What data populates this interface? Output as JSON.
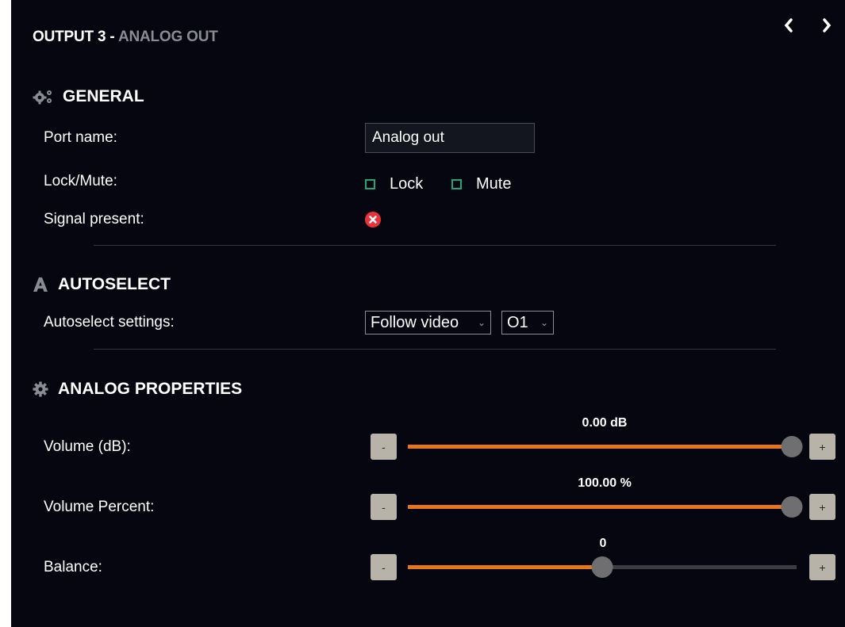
{
  "header": {
    "title": "OUTPUT 3 - ",
    "subtitle": "ANALOG OUT"
  },
  "nav": {
    "prev_icon": "chevron-left-icon",
    "next_icon": "chevron-right-icon"
  },
  "general": {
    "title": "GENERAL",
    "icon": "gears-icon",
    "port_name_label": "Port name:",
    "port_name_value": "Analog out",
    "lock_mute_label": "Lock/Mute:",
    "lock_label": "Lock",
    "lock_checked": false,
    "mute_label": "Mute",
    "mute_checked": false,
    "signal_label": "Signal present:",
    "signal_present": false,
    "signal_icon": "error-x-icon"
  },
  "autoselect": {
    "title": "AUTOSELECT",
    "icon": "letter-a-icon",
    "settings_label": "Autoselect settings:",
    "mode_value": "Follow video",
    "port_value": "O1"
  },
  "analog": {
    "title": "ANALOG PROPERTIES",
    "icon": "gear-icon",
    "minus_label": "-",
    "plus_label": "+",
    "sliders": [
      {
        "label": "Volume (dB):",
        "value_text": "0.00 dB",
        "level": 1.0
      },
      {
        "label": "Volume Percent:",
        "value_text": "100.00 %",
        "level": 1.0
      },
      {
        "label": "Balance:",
        "value_text": "0",
        "level": 0.5
      }
    ]
  },
  "colors": {
    "accent": "#e8751a",
    "checkbox": "#21a67a",
    "error": "#e8333a",
    "background": "#05060f"
  }
}
